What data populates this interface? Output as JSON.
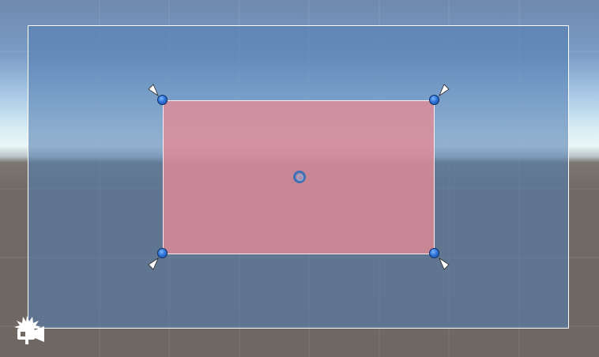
{
  "scene_view": {
    "gizmos": {
      "rect_handles": [
        "top-left",
        "top-right",
        "bottom-left",
        "bottom-right"
      ],
      "anchor_markers": [
        "top-left",
        "top-right",
        "bottom-left",
        "bottom-right"
      ],
      "pivot": "center",
      "camera_icon": "camera-gizmo-icon"
    },
    "colors": {
      "sky_top": "#6f89ad",
      "horizon": "#e9f6f6",
      "ground": "#6f6862",
      "canvas_fill": "#527db2",
      "canvas_border": "#ffffff",
      "panel_fill": "#e28b96",
      "handle": "#2f74d8",
      "pivot": "#3f6fb6"
    }
  }
}
